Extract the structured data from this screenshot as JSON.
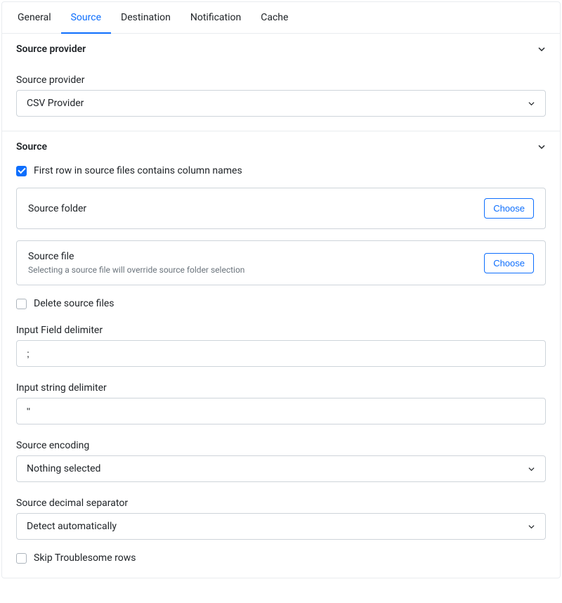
{
  "tabs": {
    "general": "General",
    "source": "Source",
    "destination": "Destination",
    "notification": "Notification",
    "cache": "Cache"
  },
  "section_provider": {
    "title": "Source provider",
    "field_label": "Source provider",
    "selected": "CSV Provider"
  },
  "section_source": {
    "title": "Source",
    "first_row_label": "First row in source files contains column names",
    "first_row_checked": true,
    "source_folder": {
      "label": "Source folder",
      "choose": "Choose"
    },
    "source_file": {
      "label": "Source file",
      "hint": "Selecting a source file will override source folder selection",
      "choose": "Choose"
    },
    "delete_source_label": "Delete source files",
    "delete_source_checked": false,
    "field_delimiter": {
      "label": "Input Field delimiter",
      "value": ";"
    },
    "string_delimiter": {
      "label": "Input string delimiter",
      "value": "\""
    },
    "encoding": {
      "label": "Source encoding",
      "selected": "Nothing selected"
    },
    "decimal_separator": {
      "label": "Source decimal separator",
      "selected": "Detect automatically"
    },
    "skip_troublesome_label": "Skip Troublesome rows",
    "skip_troublesome_checked": false
  }
}
